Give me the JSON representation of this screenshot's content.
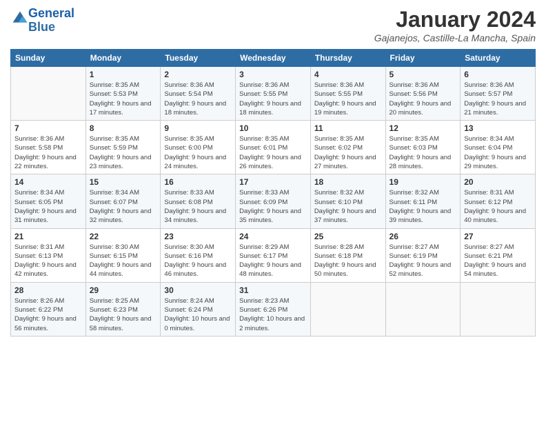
{
  "logo": {
    "line1": "General",
    "line2": "Blue"
  },
  "title": "January 2024",
  "location": "Gajanejos, Castille-La Mancha, Spain",
  "days_of_week": [
    "Sunday",
    "Monday",
    "Tuesday",
    "Wednesday",
    "Thursday",
    "Friday",
    "Saturday"
  ],
  "weeks": [
    [
      {
        "day": "",
        "sunrise": "",
        "sunset": "",
        "daylight": ""
      },
      {
        "day": "1",
        "sunrise": "Sunrise: 8:35 AM",
        "sunset": "Sunset: 5:53 PM",
        "daylight": "Daylight: 9 hours and 17 minutes."
      },
      {
        "day": "2",
        "sunrise": "Sunrise: 8:36 AM",
        "sunset": "Sunset: 5:54 PM",
        "daylight": "Daylight: 9 hours and 18 minutes."
      },
      {
        "day": "3",
        "sunrise": "Sunrise: 8:36 AM",
        "sunset": "Sunset: 5:55 PM",
        "daylight": "Daylight: 9 hours and 18 minutes."
      },
      {
        "day": "4",
        "sunrise": "Sunrise: 8:36 AM",
        "sunset": "Sunset: 5:55 PM",
        "daylight": "Daylight: 9 hours and 19 minutes."
      },
      {
        "day": "5",
        "sunrise": "Sunrise: 8:36 AM",
        "sunset": "Sunset: 5:56 PM",
        "daylight": "Daylight: 9 hours and 20 minutes."
      },
      {
        "day": "6",
        "sunrise": "Sunrise: 8:36 AM",
        "sunset": "Sunset: 5:57 PM",
        "daylight": "Daylight: 9 hours and 21 minutes."
      }
    ],
    [
      {
        "day": "7",
        "sunrise": "Sunrise: 8:36 AM",
        "sunset": "Sunset: 5:58 PM",
        "daylight": "Daylight: 9 hours and 22 minutes."
      },
      {
        "day": "8",
        "sunrise": "Sunrise: 8:35 AM",
        "sunset": "Sunset: 5:59 PM",
        "daylight": "Daylight: 9 hours and 23 minutes."
      },
      {
        "day": "9",
        "sunrise": "Sunrise: 8:35 AM",
        "sunset": "Sunset: 6:00 PM",
        "daylight": "Daylight: 9 hours and 24 minutes."
      },
      {
        "day": "10",
        "sunrise": "Sunrise: 8:35 AM",
        "sunset": "Sunset: 6:01 PM",
        "daylight": "Daylight: 9 hours and 26 minutes."
      },
      {
        "day": "11",
        "sunrise": "Sunrise: 8:35 AM",
        "sunset": "Sunset: 6:02 PM",
        "daylight": "Daylight: 9 hours and 27 minutes."
      },
      {
        "day": "12",
        "sunrise": "Sunrise: 8:35 AM",
        "sunset": "Sunset: 6:03 PM",
        "daylight": "Daylight: 9 hours and 28 minutes."
      },
      {
        "day": "13",
        "sunrise": "Sunrise: 8:34 AM",
        "sunset": "Sunset: 6:04 PM",
        "daylight": "Daylight: 9 hours and 29 minutes."
      }
    ],
    [
      {
        "day": "14",
        "sunrise": "Sunrise: 8:34 AM",
        "sunset": "Sunset: 6:05 PM",
        "daylight": "Daylight: 9 hours and 31 minutes."
      },
      {
        "day": "15",
        "sunrise": "Sunrise: 8:34 AM",
        "sunset": "Sunset: 6:07 PM",
        "daylight": "Daylight: 9 hours and 32 minutes."
      },
      {
        "day": "16",
        "sunrise": "Sunrise: 8:33 AM",
        "sunset": "Sunset: 6:08 PM",
        "daylight": "Daylight: 9 hours and 34 minutes."
      },
      {
        "day": "17",
        "sunrise": "Sunrise: 8:33 AM",
        "sunset": "Sunset: 6:09 PM",
        "daylight": "Daylight: 9 hours and 35 minutes."
      },
      {
        "day": "18",
        "sunrise": "Sunrise: 8:32 AM",
        "sunset": "Sunset: 6:10 PM",
        "daylight": "Daylight: 9 hours and 37 minutes."
      },
      {
        "day": "19",
        "sunrise": "Sunrise: 8:32 AM",
        "sunset": "Sunset: 6:11 PM",
        "daylight": "Daylight: 9 hours and 39 minutes."
      },
      {
        "day": "20",
        "sunrise": "Sunrise: 8:31 AM",
        "sunset": "Sunset: 6:12 PM",
        "daylight": "Daylight: 9 hours and 40 minutes."
      }
    ],
    [
      {
        "day": "21",
        "sunrise": "Sunrise: 8:31 AM",
        "sunset": "Sunset: 6:13 PM",
        "daylight": "Daylight: 9 hours and 42 minutes."
      },
      {
        "day": "22",
        "sunrise": "Sunrise: 8:30 AM",
        "sunset": "Sunset: 6:15 PM",
        "daylight": "Daylight: 9 hours and 44 minutes."
      },
      {
        "day": "23",
        "sunrise": "Sunrise: 8:30 AM",
        "sunset": "Sunset: 6:16 PM",
        "daylight": "Daylight: 9 hours and 46 minutes."
      },
      {
        "day": "24",
        "sunrise": "Sunrise: 8:29 AM",
        "sunset": "Sunset: 6:17 PM",
        "daylight": "Daylight: 9 hours and 48 minutes."
      },
      {
        "day": "25",
        "sunrise": "Sunrise: 8:28 AM",
        "sunset": "Sunset: 6:18 PM",
        "daylight": "Daylight: 9 hours and 50 minutes."
      },
      {
        "day": "26",
        "sunrise": "Sunrise: 8:27 AM",
        "sunset": "Sunset: 6:19 PM",
        "daylight": "Daylight: 9 hours and 52 minutes."
      },
      {
        "day": "27",
        "sunrise": "Sunrise: 8:27 AM",
        "sunset": "Sunset: 6:21 PM",
        "daylight": "Daylight: 9 hours and 54 minutes."
      }
    ],
    [
      {
        "day": "28",
        "sunrise": "Sunrise: 8:26 AM",
        "sunset": "Sunset: 6:22 PM",
        "daylight": "Daylight: 9 hours and 56 minutes."
      },
      {
        "day": "29",
        "sunrise": "Sunrise: 8:25 AM",
        "sunset": "Sunset: 6:23 PM",
        "daylight": "Daylight: 9 hours and 58 minutes."
      },
      {
        "day": "30",
        "sunrise": "Sunrise: 8:24 AM",
        "sunset": "Sunset: 6:24 PM",
        "daylight": "Daylight: 10 hours and 0 minutes."
      },
      {
        "day": "31",
        "sunrise": "Sunrise: 8:23 AM",
        "sunset": "Sunset: 6:26 PM",
        "daylight": "Daylight: 10 hours and 2 minutes."
      },
      {
        "day": "",
        "sunrise": "",
        "sunset": "",
        "daylight": ""
      },
      {
        "day": "",
        "sunrise": "",
        "sunset": "",
        "daylight": ""
      },
      {
        "day": "",
        "sunrise": "",
        "sunset": "",
        "daylight": ""
      }
    ]
  ]
}
